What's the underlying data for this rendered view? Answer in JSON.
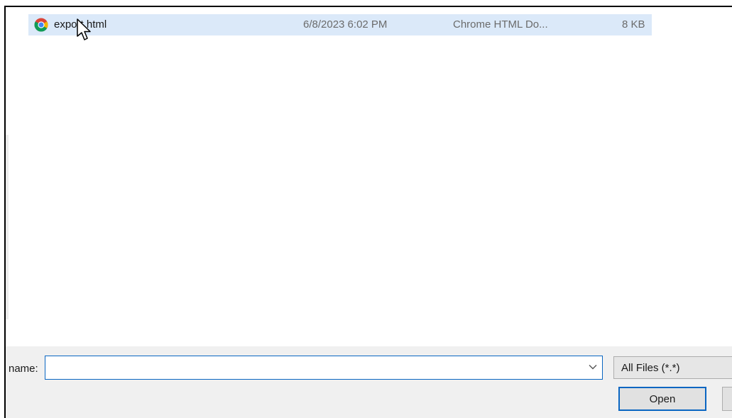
{
  "file_list": {
    "rows": [
      {
        "name": "export.html",
        "date_modified": "6/8/2023 6:02 PM",
        "type": "Chrome HTML Do...",
        "size": "8 KB",
        "icon": "chrome-icon",
        "selected": true
      }
    ]
  },
  "footer": {
    "file_name_label": "name:",
    "file_name_value": "",
    "file_type_filter": "All Files (*.*)",
    "open_label": "Open",
    "cancel_label": ""
  },
  "colors": {
    "selection": "#dbe9f9",
    "accent": "#0a66c2",
    "panel": "#f0f0f0"
  }
}
